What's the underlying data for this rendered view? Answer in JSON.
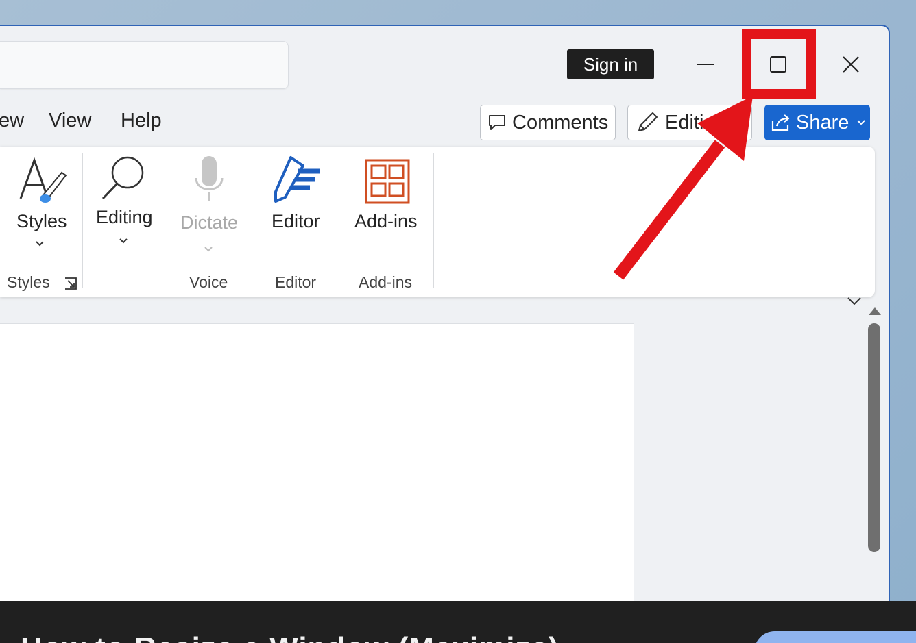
{
  "titlebar": {
    "sign_in_label": "Sign in",
    "minimize_icon": "minimize-icon",
    "maximize_icon": "maximize-icon",
    "close_icon": "close-icon"
  },
  "tabs": [
    {
      "label": "ew"
    },
    {
      "label": "View"
    },
    {
      "label": "Help"
    }
  ],
  "top_buttons": {
    "comments_label": "Comments",
    "editing_label": "Editi",
    "share_label": "Share"
  },
  "ribbon": {
    "styles_label": "Styles",
    "editing_label": "Editing",
    "dictate_label": "Dictate",
    "editor_label": "Editor",
    "addins_label": "Add-ins",
    "groups": {
      "styles": "Styles",
      "voice": "Voice",
      "editor": "Editor",
      "addins": "Add-ins"
    }
  },
  "colors": {
    "share_blue": "#1966cf",
    "highlight_red": "#e3151a",
    "addins_orange": "#d04f23"
  },
  "caption": {
    "text": "How to Resize a Window (Maximize)"
  }
}
